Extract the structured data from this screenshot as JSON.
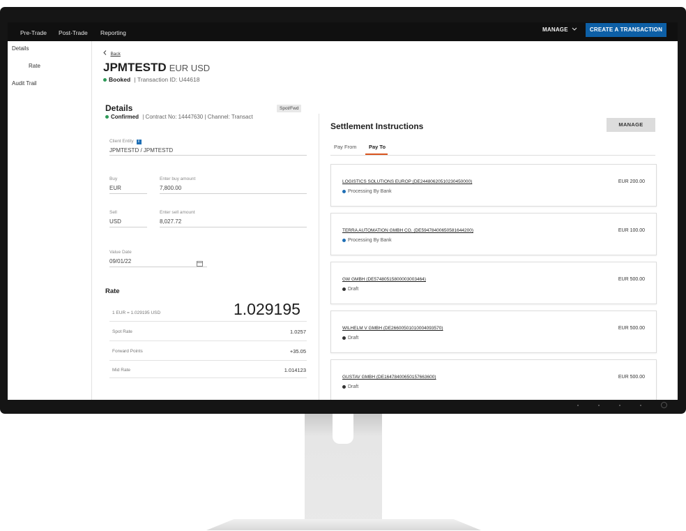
{
  "topbar": {
    "nav": [
      "Pre-Trade",
      "Post-Trade",
      "Reporting"
    ],
    "manage_label": "MANAGE",
    "create_label": "CREATE A TRANSACTION"
  },
  "sidebar": {
    "items": [
      {
        "label": "Details"
      },
      {
        "label": "Rate"
      },
      {
        "label": "Audit Trail"
      }
    ]
  },
  "header": {
    "back_label": "Back",
    "ticker": "JPMTESTD",
    "pair": "EUR USD",
    "status": "Booked",
    "transaction_id": "| Transaction ID: U44618"
  },
  "details": {
    "title": "Details",
    "badge": "Spot/Fwd",
    "status": "Confirmed",
    "meta": "| Contract No: 14447630 | Channel: Transact",
    "client_entity_label": "Client Entity",
    "client_entity_value": "JPMTESTD / JPMTESTD",
    "buy_label": "Buy",
    "buy_currency": "EUR",
    "buy_amount_label": "Enter buy amount",
    "buy_amount": "7,800.00",
    "sell_label": "Sell",
    "sell_currency": "USD",
    "sell_amount_label": "Enter sell amount",
    "sell_amount": "8,027.72",
    "value_date_label": "Value Date",
    "value_date": "09/01/22"
  },
  "rate": {
    "title": "Rate",
    "conversion": "1 EUR = 1.029195 USD",
    "big_rate": "1.029195",
    "rows": [
      {
        "label": "Spot Rate",
        "value": "1.0257"
      },
      {
        "label": "Forward Points",
        "value": "+35.05"
      },
      {
        "label": "Mid Rate",
        "value": "1.014123"
      }
    ]
  },
  "settlement": {
    "title": "Settlement Instructions",
    "manage_label": "MANAGE",
    "tabs": [
      {
        "label": "Pay From"
      },
      {
        "label": "Pay To"
      }
    ],
    "active_tab": "Pay To",
    "cards": [
      {
        "name": "LOGISTICS SOLUTIONS EUROP (DE24480620510230450000)",
        "status": "Processing By Bank",
        "amount": "EUR 200.00",
        "status_color": "#1f6fb5"
      },
      {
        "name": "TERRA AUTOMATION GMBH CO. (DE59478400650581644200)",
        "status": "Processing By Bank",
        "amount": "EUR 100.00",
        "status_color": "#1f6fb5"
      },
      {
        "name": "GW GMBH (DE57480515800003003464)",
        "status": "Draft",
        "amount": "EUR 500.00",
        "status_color": "#333333"
      },
      {
        "name": "WILHELM V GMBH (DE26600501010004093570)",
        "status": "Draft",
        "amount": "EUR 500.00",
        "status_color": "#333333"
      },
      {
        "name": "GUSTAV GMBH (DE16478400650157663600)",
        "status": "Draft",
        "amount": "EUR 500.00",
        "status_color": "#333333"
      }
    ]
  },
  "colors": {
    "accent": "#0d5fa6",
    "success": "#2e9a58",
    "tab_underline": "#d9541e"
  }
}
